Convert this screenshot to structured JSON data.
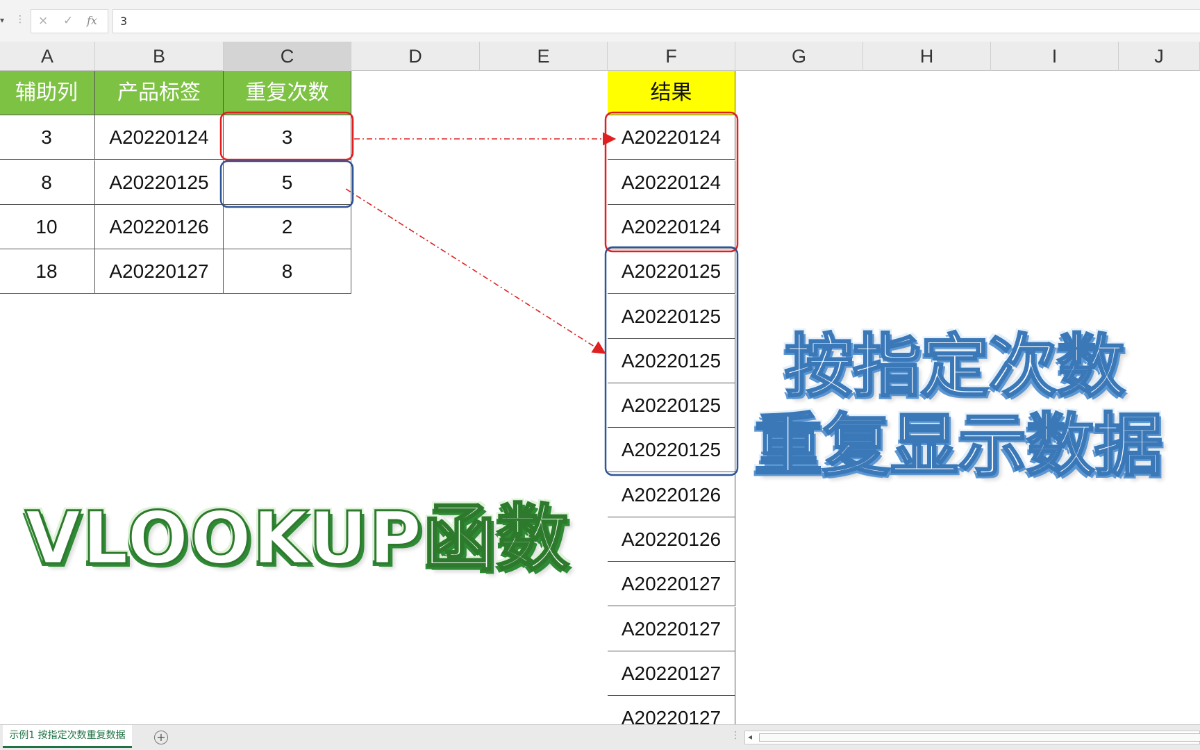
{
  "formula_bar": {
    "cancel_icon": "×",
    "confirm_icon": "✓",
    "fx_label": "fx",
    "value": "3"
  },
  "columns": [
    "A",
    "B",
    "C",
    "D",
    "E",
    "F",
    "G",
    "H",
    "I",
    "J"
  ],
  "active_column": "C",
  "left_table": {
    "headers": [
      "辅助列",
      "产品标签",
      "重复次数"
    ],
    "rows": [
      [
        "3",
        "A20220124",
        "3"
      ],
      [
        "8",
        "A20220125",
        "5"
      ],
      [
        "10",
        "A20220126",
        "2"
      ],
      [
        "18",
        "A20220127",
        "8"
      ]
    ],
    "header_color": "#7dc243"
  },
  "result": {
    "header": "结果",
    "header_color": "#ffff00",
    "values": [
      "A20220124",
      "A20220124",
      "A20220124",
      "A20220125",
      "A20220125",
      "A20220125",
      "A20220125",
      "A20220125",
      "A20220126",
      "A20220126",
      "A20220127",
      "A20220127",
      "A20220127",
      "A20220127"
    ]
  },
  "highlight_colors": {
    "red": "#e02020",
    "blue": "#2f5597"
  },
  "titles": {
    "main": "VLOOKUP函数",
    "line1": "按指定次数",
    "line2": "重复显示数据"
  },
  "status_bar": {
    "sheet_tab": "示例1 按指定次数重复数据",
    "add_sheet": "⊕"
  }
}
